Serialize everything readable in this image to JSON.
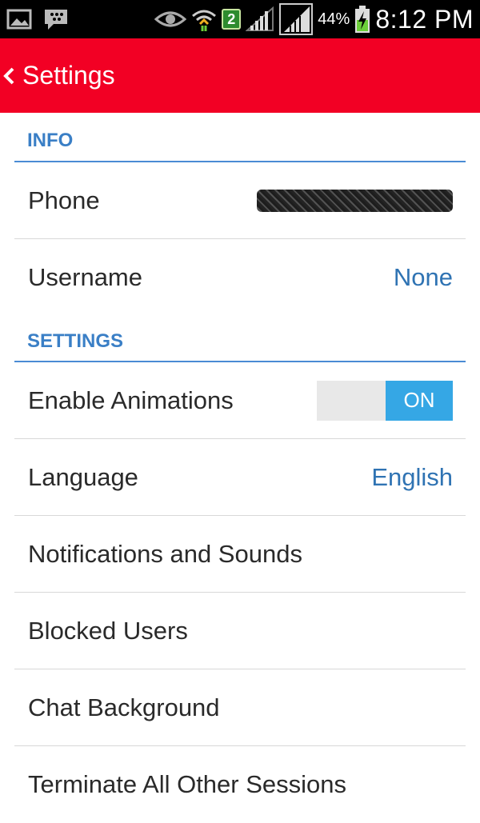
{
  "status_bar": {
    "network_badge": "2",
    "battery_percent": "44%",
    "time": "8:12 PM",
    "icons": [
      "image-icon",
      "bbm-icon",
      "eye-icon",
      "wifi-icon",
      "signal-icon",
      "signal-icon",
      "battery-charging-icon"
    ]
  },
  "app_bar": {
    "back_glyph": "‹",
    "title": "Settings",
    "color": "#f20024"
  },
  "sections": {
    "info": {
      "header": "INFO",
      "phone": {
        "label": "Phone",
        "value_redacted": true
      },
      "username": {
        "label": "Username",
        "value": "None"
      }
    },
    "settings": {
      "header": "SETTINGS",
      "animations": {
        "label": "Enable Animations",
        "toggle": "ON"
      },
      "language": {
        "label": "Language",
        "value": "English"
      },
      "notifications": {
        "label": "Notifications and Sounds"
      },
      "blocked": {
        "label": "Blocked Users"
      },
      "background": {
        "label": "Chat Background"
      },
      "terminate": {
        "label": "Terminate All Other Sessions"
      }
    }
  },
  "colors": {
    "accent": "#3a7fc6",
    "toggle_on": "#35a7e5"
  }
}
